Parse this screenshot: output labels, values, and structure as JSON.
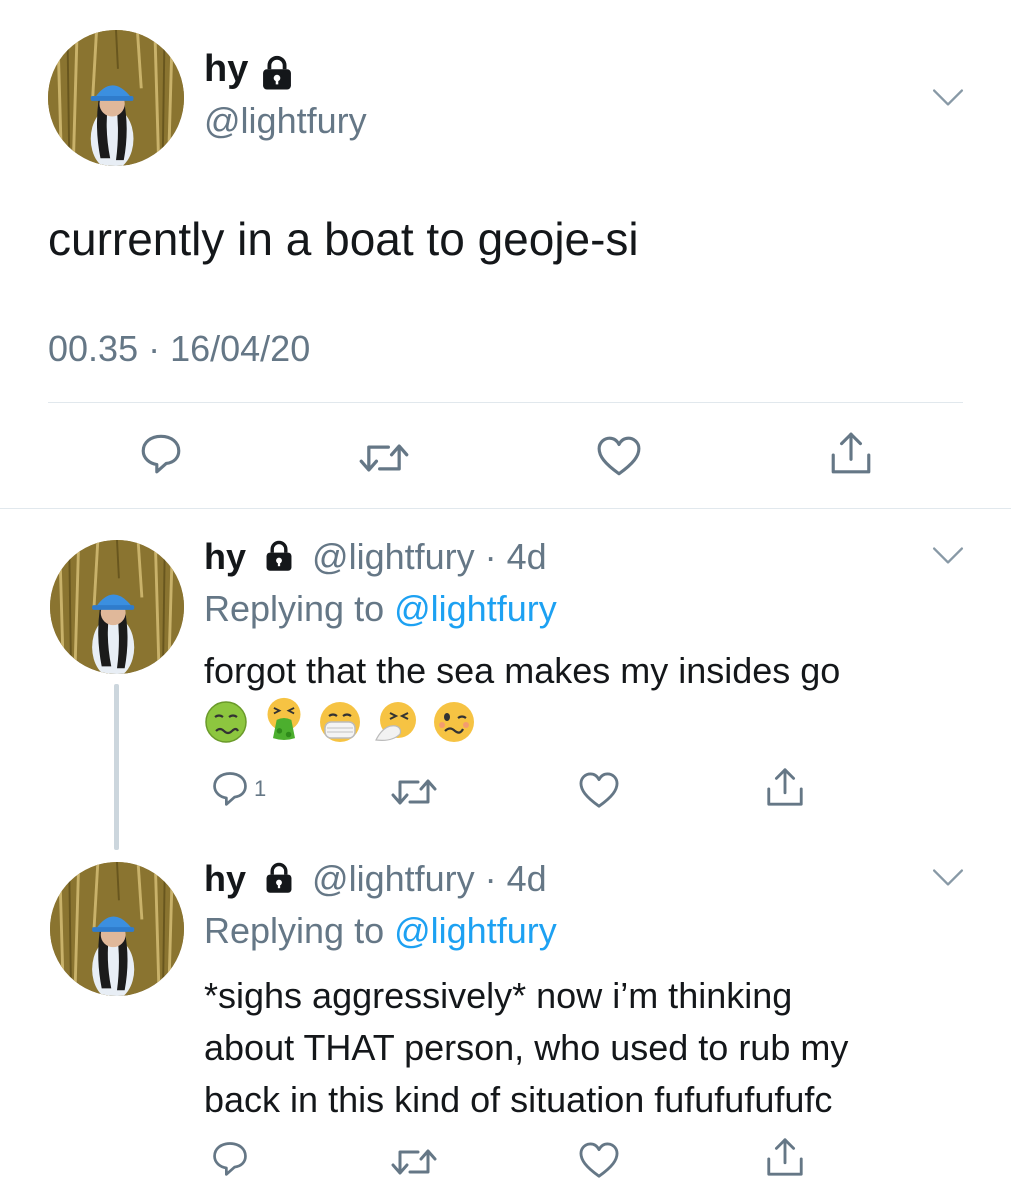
{
  "main_tweet": {
    "name": "hy",
    "handle": "@lightfury",
    "text": "currently in a boat to geoje-si",
    "timestamp": "00.35 · 16/04/20"
  },
  "replies": [
    {
      "name": "hy",
      "handle": "@lightfury",
      "age": "· 4d",
      "replying_prefix": "Replying to ",
      "replying_handle": "@lightfury",
      "text_line1": "forgot that the sea makes my insides go",
      "emojis": [
        "nauseated-face",
        "vomiting-face",
        "mask-face",
        "sneezing-face",
        "woozy-face"
      ],
      "reply_count": "1"
    },
    {
      "name": "hy",
      "handle": "@lightfury",
      "age": "· 4d",
      "replying_prefix": "Replying to ",
      "replying_handle": "@lightfury",
      "text_line1": "*sighs aggressively* now i’m thinking",
      "text_line2": "about THAT person, who used to rub my",
      "text_line3": "back in this kind of situation fufufufufufc",
      "reply_count": ""
    }
  ],
  "icons": [
    "lock-icon",
    "chevron-down-icon",
    "reply-icon",
    "retweet-icon",
    "like-icon",
    "share-icon"
  ],
  "colors": {
    "text": "#14171a",
    "secondary": "#657786",
    "link": "#1da1f2",
    "divider": "#e1e8ed",
    "thread_line": "#ccd6dd"
  }
}
